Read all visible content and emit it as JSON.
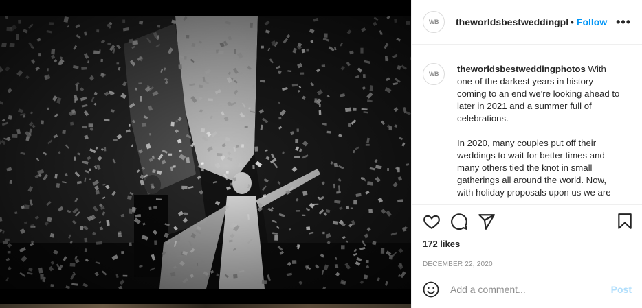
{
  "post": {
    "username": "theworldsbestweddingphotos",
    "username_truncated": "theworldsbestweddingph",
    "avatar_text": "WB",
    "separator": "•",
    "follow_label": "Follow",
    "more_icon": "more-horizontal-icon",
    "more_label": "•••"
  },
  "caption": {
    "username": "theworldsbestweddingphotos",
    "paragraph_1": "With one of the darkest years in history coming to an end we're looking ahead to later in 2021 and a summer full of celebrations.",
    "paragraph_2": "In 2020, many couples put off their weddings to wait for better times and many others tied the knot in small gatherings all around the world. Now, with holiday proposals upon us we are"
  },
  "actions": {
    "like_icon": "heart-icon",
    "comment_icon": "comment-icon",
    "share_icon": "paper-plane-icon",
    "save_icon": "bookmark-icon"
  },
  "likes_text": "172 likes",
  "date_text": "DECEMBER 22, 2020",
  "comment": {
    "emoji_icon": "smiley-icon",
    "placeholder": "Add a comment...",
    "post_label": "Post"
  },
  "colors": {
    "follow": "#0095f6",
    "post_disabled": "#b2dffc",
    "muted": "#8e8e8e",
    "text": "#262626",
    "divider": "#efefef"
  }
}
